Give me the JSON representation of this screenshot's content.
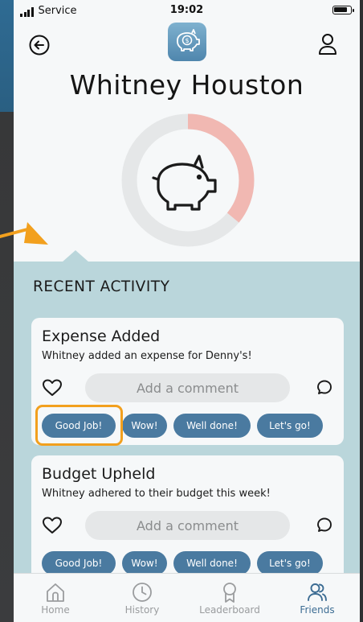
{
  "status_bar": {
    "carrier": "Service",
    "time": "19:02"
  },
  "header": {
    "logo_icon": "piggy-bank-dollar-icon",
    "back_icon": "back-arrow-icon",
    "profile_icon": "user-icon"
  },
  "profile": {
    "name": "Whitney Houston",
    "budget_progress_fraction": 0.36,
    "colors": {
      "progress": "#f1b8b2",
      "track": "#e5e7e8"
    }
  },
  "activity": {
    "heading": "RECENT ACTIVITY",
    "cards": [
      {
        "title": "Expense Added",
        "description": "Whitney added an expense for Denny's!",
        "comment_placeholder": "Add a comment",
        "reactions": [
          "Good Job!",
          "Wow!",
          "Well done!",
          "Let's go!"
        ],
        "highlighted_reaction": "Good Job!"
      },
      {
        "title": "Budget Upheld",
        "description": "Whitney adhered to their budget this week!",
        "comment_placeholder": "Add a comment",
        "reactions": [
          "Good Job!",
          "Wow!",
          "Well done!",
          "Let's go!"
        ]
      }
    ]
  },
  "tabs": [
    {
      "label": "Home",
      "icon": "home-icon",
      "active": false
    },
    {
      "label": "History",
      "icon": "clock-icon",
      "active": false
    },
    {
      "label": "Leaderboard",
      "icon": "award-ribbon-icon",
      "active": false
    },
    {
      "label": "Friends",
      "icon": "friends-icon",
      "active": true
    }
  ],
  "colors": {
    "accent": "#4a7aa0",
    "panel": "#bad6db",
    "highlight": "#f2a01e",
    "active_tab": "#3c6c93"
  }
}
